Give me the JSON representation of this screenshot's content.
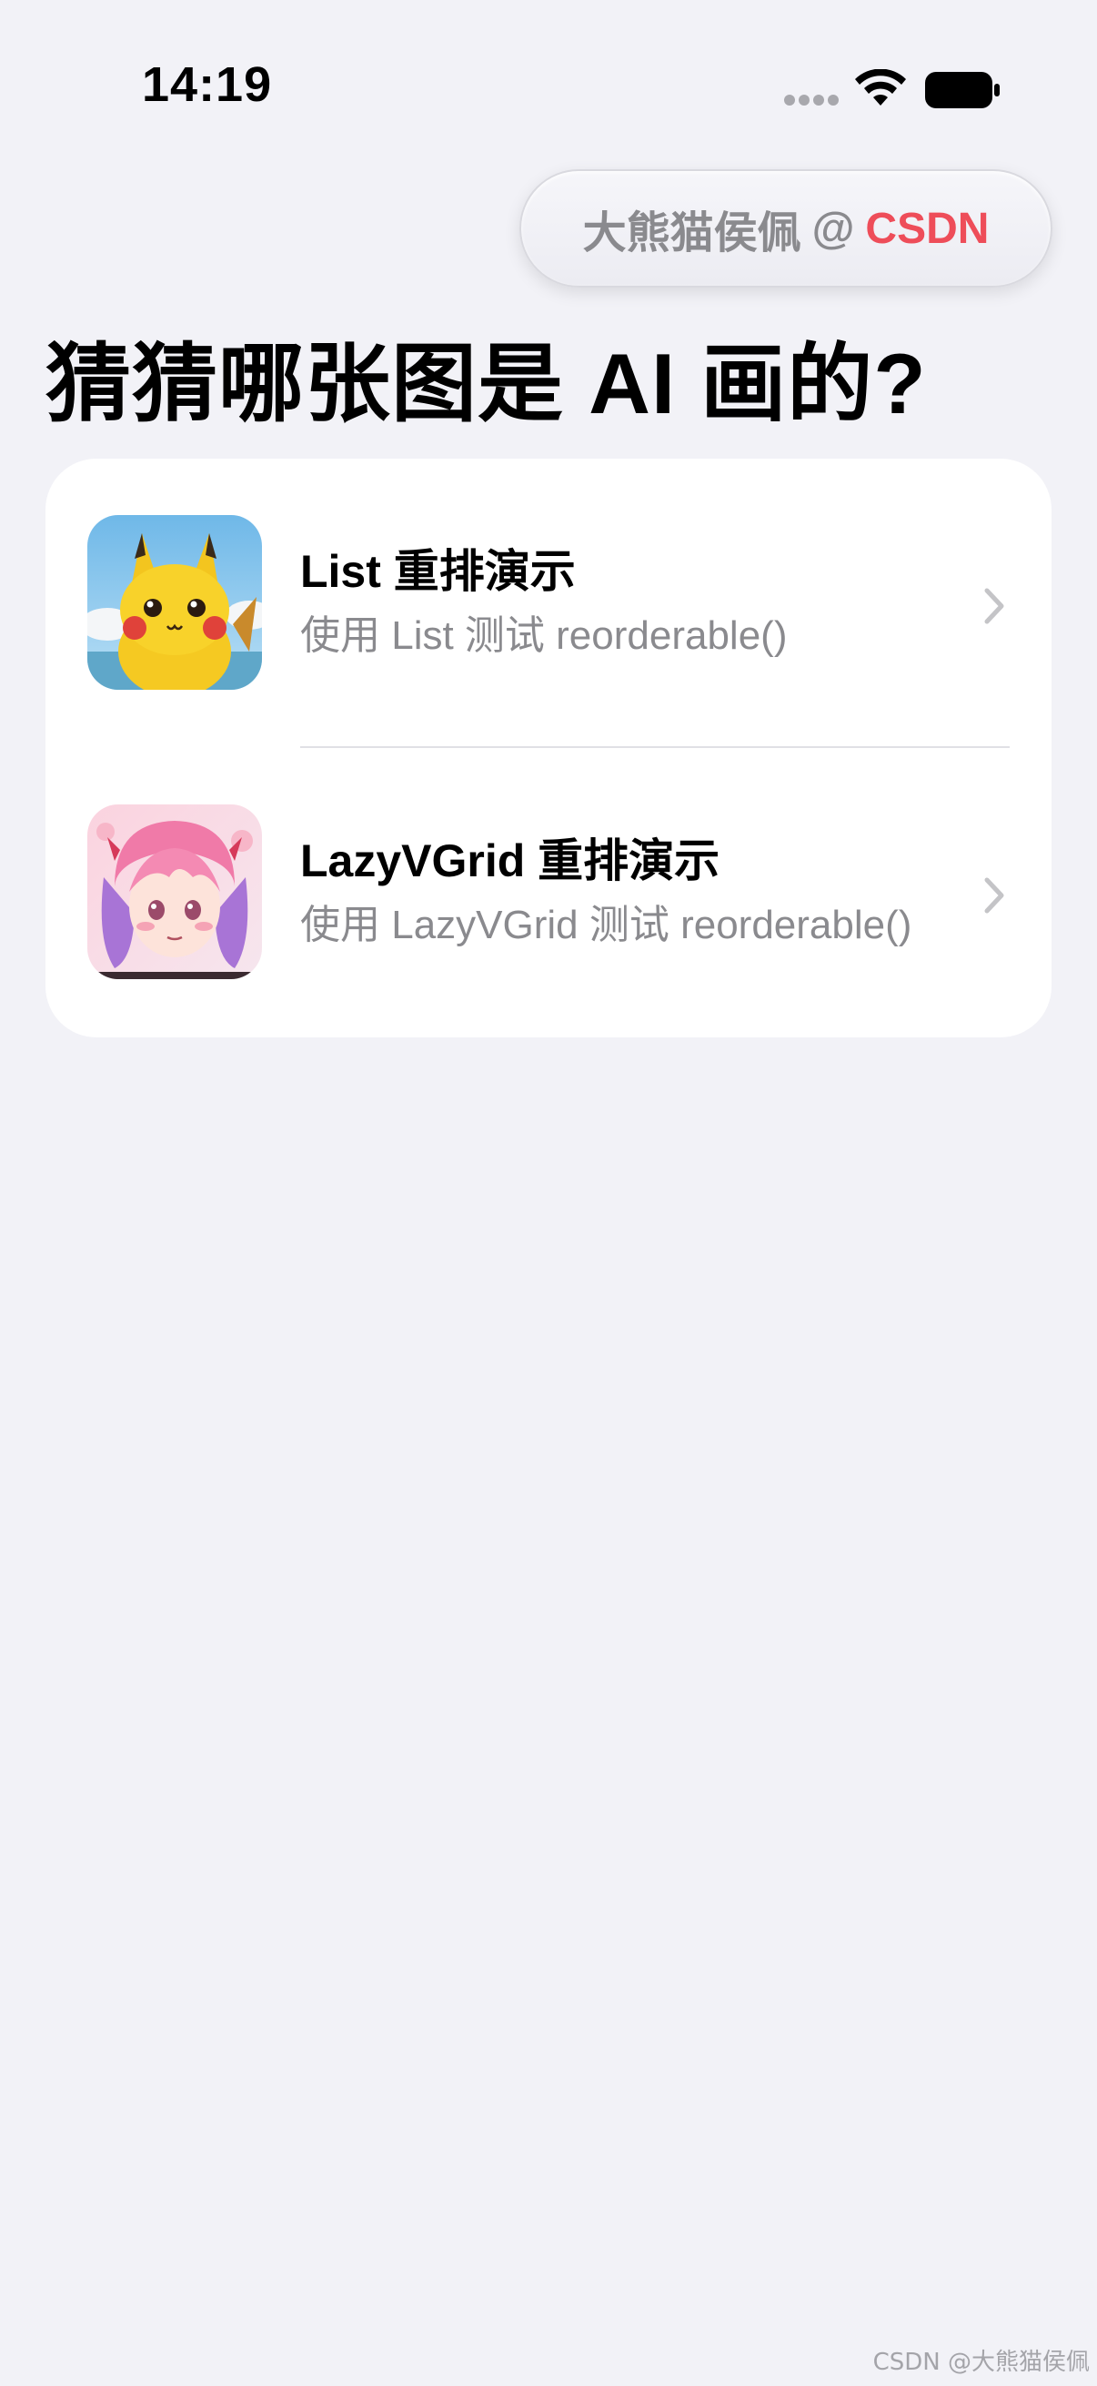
{
  "status_bar": {
    "time": "14:19"
  },
  "watermark_pill": {
    "author": "大熊猫侯佩",
    "at": "@",
    "brand": "CSDN",
    "brand_color": "#ee4d59"
  },
  "page": {
    "title": "猜猜哪张图是 AI 画的?"
  },
  "list": {
    "items": [
      {
        "title": "List 重排演示",
        "subtitle": "使用 List 测试 reorderable()",
        "thumbnail_icon": "pikachu-thumbnail",
        "chevron_icon": "chevron-right-icon"
      },
      {
        "title": "LazyVGrid 重排演示",
        "subtitle": "使用 LazyVGrid 测试 reorderable()",
        "thumbnail_icon": "anime-girl-thumbnail",
        "chevron_icon": "chevron-right-icon"
      }
    ]
  },
  "footer": {
    "watermark": "CSDN @大熊猫侯佩"
  },
  "colors": {
    "background": "#f2f2f7",
    "card": "#ffffff",
    "secondary_text": "#8a8a8e",
    "chevron": "#c4c4c7"
  }
}
